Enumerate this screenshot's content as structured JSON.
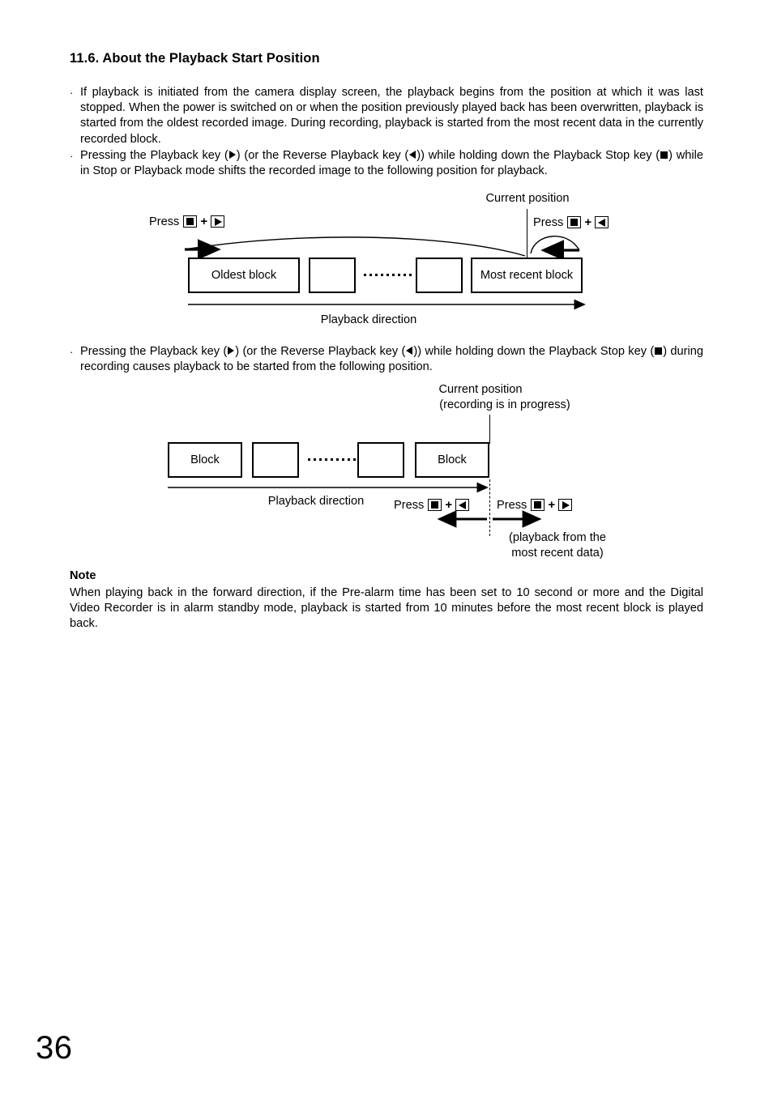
{
  "heading": "11.6. About the Playback Start Position",
  "paragraphs": {
    "p1_a": "If playback is initiated from the camera display screen, the playback begins from the position at which it was last stopped. When the power is switched on or when the position previously played back has been overwritten, playback is started from the oldest recorded image. During recording, playback is started from the most recent data in the currently recorded block.",
    "p2_a": "Pressing the Playback key (",
    "p2_b": ") (or the Reverse Playback key (",
    "p2_c": ")) while holding down the Playback Stop key (",
    "p2_d": ") while in Stop or Playback mode shifts the recorded image to the following position for playback.",
    "p3_a": "Pressing the Playback key (",
    "p3_b": ") (or the Reverse Playback key (",
    "p3_c": ")) while holding down the Playback Stop key (",
    "p3_d": ") during recording causes playback to be started from the following position.",
    "bullet": "·"
  },
  "diagram1": {
    "press_left_label": "Press",
    "press_right_label": "Press",
    "plus": "+",
    "current_position": "Current position",
    "block_oldest": "Oldest block",
    "block_empty_1": "",
    "block_empty_2": "",
    "block_most_recent": "Most recent block",
    "playback_direction": "Playback direction"
  },
  "diagram2": {
    "current_position_line1": "Current position",
    "current_position_line2": "(recording is in progress)",
    "block_first": "Block",
    "block_empty_1": "",
    "block_empty_2": "",
    "block_last": "Block",
    "playback_direction": "Playback direction",
    "press_reverse_label": "Press",
    "press_forward_label": "Press",
    "plus": "+",
    "note_line1": "(playback from the",
    "note_line2": "most recent data)"
  },
  "note": {
    "title": "Note",
    "body": "When playing back in the forward direction, if the Pre-alarm time has been set to 10 second or more and the Digital Video Recorder is in alarm standby mode, playback is started from 10 minutes before the most recent block is played back."
  },
  "page_number": "36",
  "colors": {
    "ink": "#000000",
    "paper": "#ffffff"
  }
}
